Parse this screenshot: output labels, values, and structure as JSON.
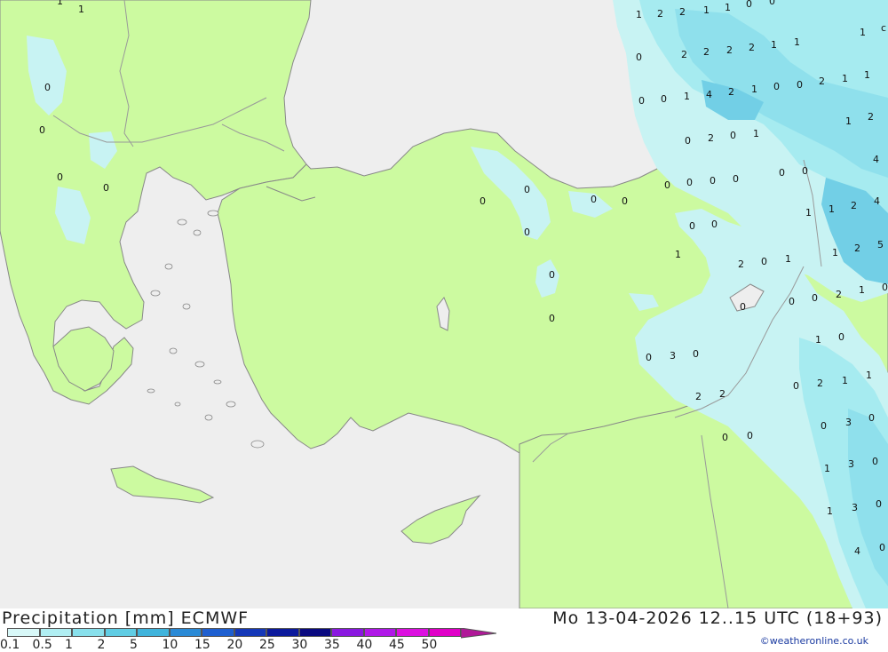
{
  "map": {
    "colors": {
      "sea": "#eeeeee",
      "land": "#ccfaa0",
      "precip_0_1": "#c8f3f3",
      "precip_0_5": "#a6ebf0",
      "precip_1": "#8fe0ec",
      "precip_2": "#72cfe6",
      "border": "#999999",
      "coast": "#888888"
    },
    "values": [
      {
        "t": "1"
      },
      {
        "t": "1"
      },
      {
        "t": "1"
      },
      {
        "t": "2"
      },
      {
        "t": "2"
      },
      {
        "t": "1"
      },
      {
        "t": "1"
      },
      {
        "t": "0"
      },
      {
        "t": "0"
      },
      {
        "t": "1"
      },
      {
        "t": "c"
      },
      {
        "t": "0"
      },
      {
        "t": "2"
      },
      {
        "t": "2"
      },
      {
        "t": "2"
      },
      {
        "t": "2"
      },
      {
        "t": "1"
      },
      {
        "t": "1"
      },
      {
        "t": "0"
      },
      {
        "t": "0"
      },
      {
        "t": "1"
      },
      {
        "t": "4"
      },
      {
        "t": "2"
      },
      {
        "t": "1"
      },
      {
        "t": "0"
      },
      {
        "t": "0"
      },
      {
        "t": "2"
      },
      {
        "t": "1"
      },
      {
        "t": "1"
      },
      {
        "t": "0"
      },
      {
        "t": "0"
      },
      {
        "t": "2"
      },
      {
        "t": "0"
      },
      {
        "t": "1"
      },
      {
        "t": "1"
      },
      {
        "t": "2"
      },
      {
        "t": "4"
      },
      {
        "t": "0"
      },
      {
        "t": "0"
      },
      {
        "t": "0"
      },
      {
        "t": "0"
      },
      {
        "t": "0"
      },
      {
        "t": "0"
      },
      {
        "t": "0"
      },
      {
        "t": "0"
      },
      {
        "t": "0"
      },
      {
        "t": "0"
      },
      {
        "t": "1"
      },
      {
        "t": "1"
      },
      {
        "t": "2"
      },
      {
        "t": "4"
      },
      {
        "t": "0"
      },
      {
        "t": "0"
      },
      {
        "t": "0"
      },
      {
        "t": "1"
      },
      {
        "t": "2"
      },
      {
        "t": "5"
      },
      {
        "t": "2"
      },
      {
        "t": "0"
      },
      {
        "t": "1"
      },
      {
        "t": "0"
      },
      {
        "t": "0"
      },
      {
        "t": "0"
      },
      {
        "t": "2"
      },
      {
        "t": "1"
      },
      {
        "t": "0"
      },
      {
        "t": "0"
      },
      {
        "t": "0"
      },
      {
        "t": "1"
      },
      {
        "t": "0"
      },
      {
        "t": "0"
      },
      {
        "t": "3"
      },
      {
        "t": "0"
      },
      {
        "t": "2"
      },
      {
        "t": "1"
      },
      {
        "t": "0"
      },
      {
        "t": "1"
      },
      {
        "t": "2"
      },
      {
        "t": "2"
      },
      {
        "t": "0"
      },
      {
        "t": "3"
      },
      {
        "t": "0"
      },
      {
        "t": "0"
      },
      {
        "t": "0"
      },
      {
        "t": "1"
      },
      {
        "t": "3"
      },
      {
        "t": "0"
      },
      {
        "t": "1"
      },
      {
        "t": "3"
      },
      {
        "t": "0"
      },
      {
        "t": "4"
      },
      {
        "t": "0"
      },
      {
        "t": "0"
      },
      {
        "t": "0"
      },
      {
        "t": "0"
      },
      {
        "t": "1"
      }
    ]
  },
  "footer": {
    "title": "Precipitation [mm] ECMWF",
    "datetime": "Mo 13-04-2026 12..15 UTC (18+93)",
    "credit": "©weatheronline.co.uk"
  },
  "legend": {
    "ticks": [
      "0.1",
      "0.5",
      "1",
      "2",
      "5",
      "10",
      "15",
      "20",
      "25",
      "30",
      "35",
      "40",
      "45",
      "50"
    ],
    "colors": [
      "#d8f8f8",
      "#b0eef2",
      "#88e0ec",
      "#60cde4",
      "#40b4dc",
      "#2a8ad6",
      "#1e5fd0",
      "#1538b8",
      "#0c1a9c",
      "#0a0a80",
      "#8a18e0",
      "#b018e8",
      "#dc10e0",
      "#e000c8",
      "#b01898"
    ]
  }
}
